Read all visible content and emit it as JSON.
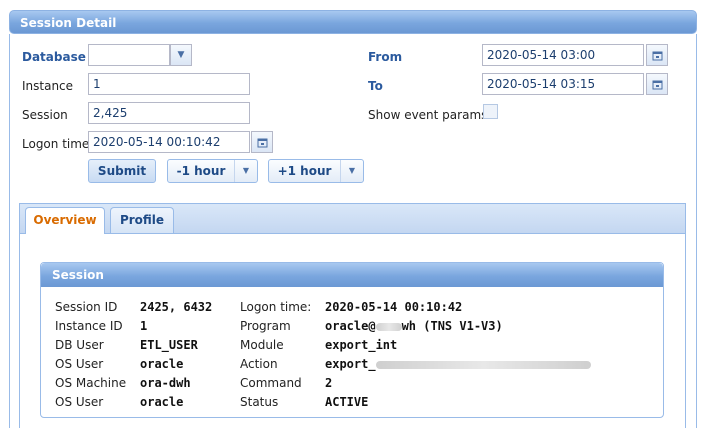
{
  "window": {
    "title": "Session Detail"
  },
  "form": {
    "database_label": "Database",
    "database_value": "",
    "instance_label": "Instance",
    "instance_value": "1",
    "session_label": "Session",
    "session_value": "2,425",
    "logon_label": "Logon time",
    "logon_value": "2020-05-14 00:10:42",
    "from_label": "From",
    "from_value": "2020-05-14 03:00",
    "to_label": "To",
    "to_value": "2020-05-14 03:15",
    "show_event_label": "Show event params",
    "show_event_checked": false,
    "submit_label": "Submit",
    "minus_hour_label": "-1 hour",
    "plus_hour_label": "+1 hour"
  },
  "tabs": [
    {
      "label": "Overview",
      "active": true
    },
    {
      "label": "Profile",
      "active": false
    }
  ],
  "session": {
    "title": "Session",
    "left": [
      {
        "key": "Session ID",
        "value": "2425, 6432"
      },
      {
        "key": "Instance ID",
        "value": "1"
      },
      {
        "key": "DB User",
        "value": "ETL_USER"
      },
      {
        "key": "OS User",
        "value": "oracle"
      },
      {
        "key": "OS Machine",
        "value": "ora-dwh"
      },
      {
        "key": "OS User",
        "value": "oracle"
      }
    ],
    "right": [
      {
        "key": "Logon time:",
        "value": "2020-05-14 00:10:42"
      },
      {
        "key": "Program",
        "value_prefix": "oracle@",
        "value_suffix": "wh (TNS V1-V3)"
      },
      {
        "key": "Module",
        "value": "export_int"
      },
      {
        "key": "Action",
        "value_prefix": "export_",
        "value_suffix": ""
      },
      {
        "key": "Command",
        "value": "2"
      },
      {
        "key": "Status",
        "value": "ACTIVE"
      }
    ]
  },
  "icons": {
    "calendar": "calendar-icon",
    "dropdown": "chevron-down-icon"
  },
  "colors": {
    "accent": "#7aa6de",
    "active_tab": "#d96b00",
    "label_blue": "#2b5a9e"
  }
}
